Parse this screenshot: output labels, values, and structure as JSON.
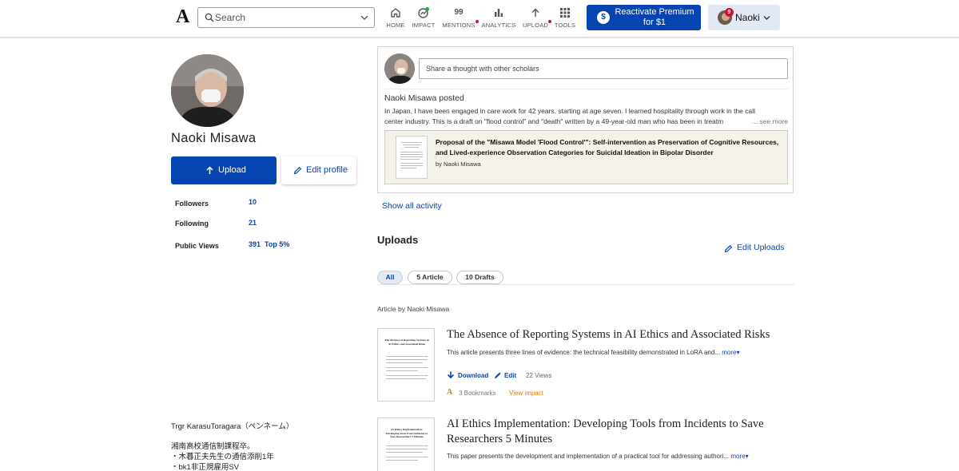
{
  "header": {
    "logo": "A",
    "search_placeholder": "Search",
    "nav": [
      {
        "label": "HOME",
        "icon": "home-icon"
      },
      {
        "label": "IMPACT",
        "icon": "impact-icon"
      },
      {
        "label": "MENTIONS",
        "icon": "mentions-icon",
        "count": "99"
      },
      {
        "label": "ANALYTICS",
        "icon": "analytics-icon"
      },
      {
        "label": "UPLOAD",
        "icon": "upload-icon"
      },
      {
        "label": "TOOLS",
        "icon": "grid-icon"
      }
    ],
    "premium_line1": "Reactivate Premium",
    "premium_line2": "for $1",
    "premium_icon_symbol": "$",
    "user_name": "Naoki",
    "notification_count": "9"
  },
  "profile": {
    "name": "Naoki Misawa",
    "upload_label": "Upload",
    "edit_profile_label": "Edit profile",
    "stats": [
      {
        "label": "Followers",
        "value": "10"
      },
      {
        "label": "Following",
        "value": "21"
      },
      {
        "label": "Public Views",
        "value": "391",
        "extra": "Top 5%"
      }
    ],
    "bio": [
      "Trgr KarasuToragara（ペンネーム）",
      "",
      "湘南高校通信制課程卒。",
      "・木暮正夫先生の通信添削1年",
      "・bk1非正規雇用SV"
    ]
  },
  "activity": {
    "thought_placeholder": "Share a thought with other scholars",
    "post_header": "Naoki Misawa posted",
    "post_text_line1": "In Japan, I have been engaged in care work for 42 years, starting at age seven. I learned hospitality through work in the call",
    "post_text_line2": "center industry. This is a draft on \"flood control\" and \"death\" written by a 49-year-old man who has been in treatm",
    "see_more": "... see more",
    "paper_title": "Proposal of the \"Misawa Model 'Flood Control'\": Self-intervention as Preservation of Cognitive Resources, and Lived-experience Observation Categories for Suicidal Ideation in Bipolar Disorder",
    "paper_by": "by Naoki Misawa",
    "show_all": "Show all activity"
  },
  "uploads": {
    "title": "Uploads",
    "edit_label": "Edit Uploads",
    "filters": [
      "All",
      "5 Article",
      "10 Drafts"
    ],
    "active_filter": "All",
    "section_label": "Article by Naoki Misawa",
    "works": [
      {
        "title": "The Absence of Reporting Systems in AI Ethics and Associated Risks",
        "abstract": "This article presents three lines of evidence: the technical feasibility demonstrated in LoRA and...",
        "more": "more",
        "download": "Download",
        "edit": "Edit",
        "views": "22 Views",
        "bookmarks": "3 Bookmarks",
        "view_impact": "View impact",
        "thumb_title": "The Absence of Reporting Systems in AI Ethics and Associated Risks"
      },
      {
        "title": "AI Ethics Implementation: Developing Tools from Incidents to Save Researchers 5 Minutes",
        "abstract": "This paper presents the development and implementation of a practical tool for addressing authori...",
        "more": "more",
        "thumb_title": "AI Ethics Implementation: Developing Tools from Incidents to Save Researchers 5 Minutes"
      }
    ]
  },
  "colors": {
    "brand_blue": "#0645b1",
    "alert_red": "#d0112b",
    "impact_orange": "#e07c00"
  }
}
